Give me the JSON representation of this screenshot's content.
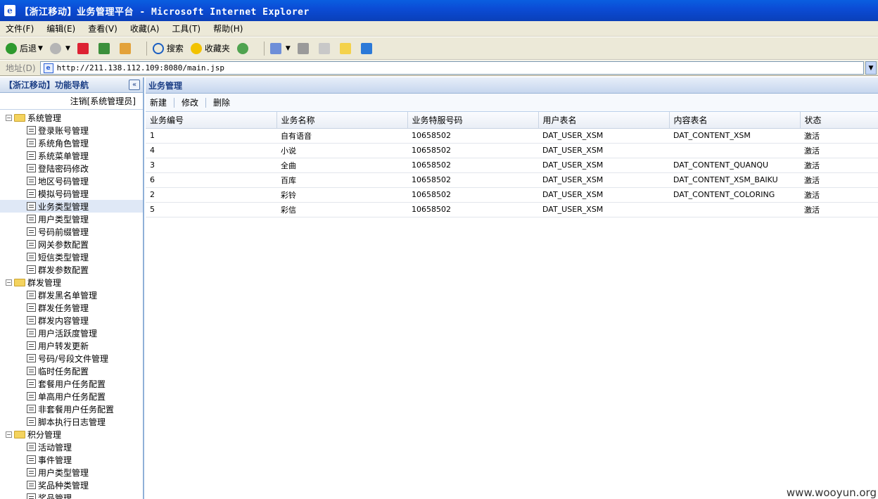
{
  "window": {
    "title": "【浙江移动】业务管理平台 - Microsoft Internet Explorer"
  },
  "menu": [
    "文件(F)",
    "编辑(E)",
    "查看(V)",
    "收藏(A)",
    "工具(T)",
    "帮助(H)"
  ],
  "toolbar": {
    "back": "后退",
    "search": "搜索",
    "favorites": "收藏夹"
  },
  "address": {
    "label": "地址(D)",
    "url": "http://211.138.112.109:8080/main.jsp"
  },
  "nav": {
    "title": "【浙江移动】功能导航",
    "logout": "注销[系统管理员]",
    "groups": [
      {
        "label": "系统管理",
        "items": [
          "登录账号管理",
          "系统角色管理",
          "系统菜单管理",
          "登陆密码修改",
          "地区号码管理",
          "模拟号码管理",
          "业务类型管理",
          "用户类型管理",
          "号码前缀管理",
          "网关参数配置",
          "短信类型管理",
          "群发参数配置"
        ]
      },
      {
        "label": "群发管理",
        "items": [
          "群发黑名单管理",
          "群发任务管理",
          "群发内容管理",
          "用户活跃度管理",
          "用户转发更新",
          "号码/号段文件管理",
          "临时任务配置",
          "套餐用户任务配置",
          "单高用户任务配置",
          "非套餐用户任务配置",
          "脚本执行日志管理"
        ]
      },
      {
        "label": "积分管理",
        "items": [
          "活动管理",
          "事件管理",
          "用户类型管理",
          "奖品种类管理",
          "奖品管理"
        ]
      }
    ],
    "selected": "业务类型管理"
  },
  "main": {
    "title": "业务管理",
    "actions": [
      "新建",
      "修改",
      "删除"
    ],
    "columns": [
      "业务编号",
      "业务名称",
      "业务特服号码",
      "用户表名",
      "内容表名",
      "状态"
    ],
    "rows": [
      [
        "1",
        "自有语音",
        "10658502",
        "DAT_USER_XSM",
        "DAT_CONTENT_XSM",
        "激活"
      ],
      [
        "4",
        "小说",
        "10658502",
        "DAT_USER_XSM",
        "",
        "激活"
      ],
      [
        "3",
        "全曲",
        "10658502",
        "DAT_USER_XSM",
        "DAT_CONTENT_QUANQU",
        "激活"
      ],
      [
        "6",
        "百库",
        "10658502",
        "DAT_USER_XSM",
        "DAT_CONTENT_XSM_BAIKU",
        "激活"
      ],
      [
        "2",
        "彩铃",
        "10658502",
        "DAT_USER_XSM",
        "DAT_CONTENT_COLORING",
        "激活"
      ],
      [
        "5",
        "彩信",
        "10658502",
        "DAT_USER_XSM",
        "",
        "激活"
      ]
    ]
  },
  "watermark": "www.wooyun.org"
}
